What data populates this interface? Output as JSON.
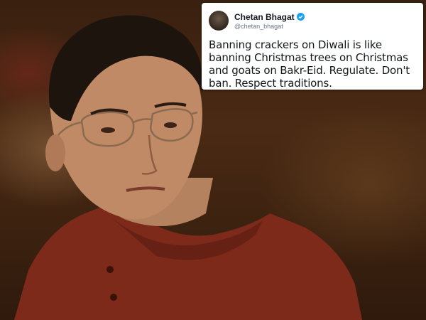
{
  "tweet": {
    "display_name": "Chetan Bhagat",
    "handle": "@chetan_bhagat",
    "verified_icon": "verified-badge-icon",
    "text": "Banning crackers on Diwali is like banning Christmas trees on Christmas and goats on Bakr-Eid. Regulate. Don't ban. Respect traditions."
  },
  "colors": {
    "verified": "#1da1f2",
    "shirt": "#8a2e1c",
    "background": "#2a1608"
  }
}
